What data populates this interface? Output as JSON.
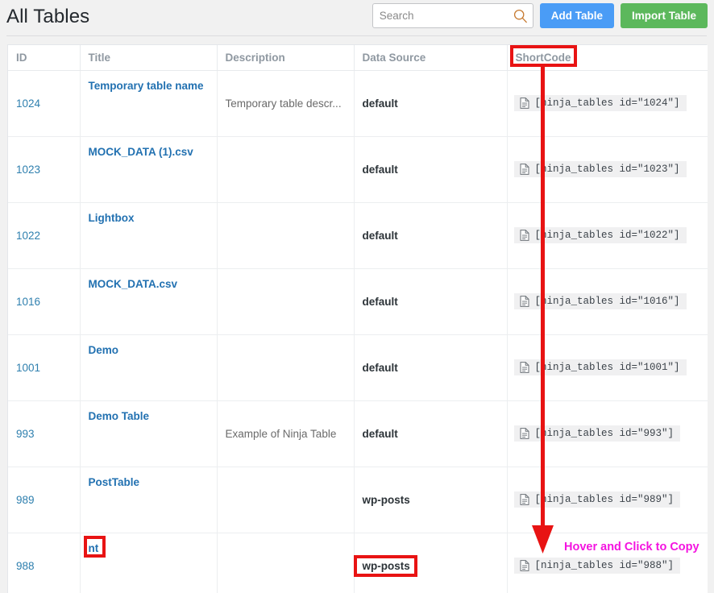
{
  "header": {
    "title": "All Tables",
    "search": {
      "placeholder": "Search",
      "value": "",
      "icon": "search-icon"
    },
    "buttons": {
      "add_table": "Add Table",
      "import_table": "Import Table"
    },
    "colors": {
      "add_table_bg": "#4a9cf6",
      "import_table_bg": "#5cb85c",
      "title": "#23282d"
    }
  },
  "table": {
    "columns": [
      "ID",
      "Title",
      "Description",
      "Data Source",
      "ShortCode"
    ],
    "rows": [
      {
        "id": "1024",
        "title": "Temporary table name",
        "description": "Temporary table descr...",
        "data_source": "default",
        "shortcode": "[ninja_tables id=\"1024\"]"
      },
      {
        "id": "1023",
        "title": "MOCK_DATA (1).csv",
        "description": "",
        "data_source": "default",
        "shortcode": "[ninja_tables id=\"1023\"]"
      },
      {
        "id": "1022",
        "title": "Lightbox",
        "description": "",
        "data_source": "default",
        "shortcode": "[ninja_tables id=\"1022\"]"
      },
      {
        "id": "1016",
        "title": "MOCK_DATA.csv",
        "description": "",
        "data_source": "default",
        "shortcode": "[ninja_tables id=\"1016\"]"
      },
      {
        "id": "1001",
        "title": "Demo",
        "description": "",
        "data_source": "default",
        "shortcode": "[ninja_tables id=\"1001\"]"
      },
      {
        "id": "993",
        "title": "Demo Table",
        "description": "Example of Ninja Table",
        "data_source": "default",
        "shortcode": "[ninja_tables id=\"993\"]"
      },
      {
        "id": "989",
        "title": "PostTable",
        "description": "",
        "data_source": "wp-posts",
        "shortcode": "[ninja_tables id=\"989\"]"
      },
      {
        "id": "988",
        "title": "nt",
        "description": "",
        "data_source": "wp-posts",
        "shortcode": "[ninja_tables id=\"988\"]"
      }
    ]
  },
  "annotations": {
    "callout_text": "Hover and Click to Copy",
    "callout_color": "#f413e0",
    "highlight_color": "#e81313",
    "highlight_targets": [
      "ShortCode",
      "nt",
      "wp-posts"
    ],
    "arrow_from": "ShortCode",
    "arrow_to": "[ninja_tables id=\"988\"]"
  }
}
